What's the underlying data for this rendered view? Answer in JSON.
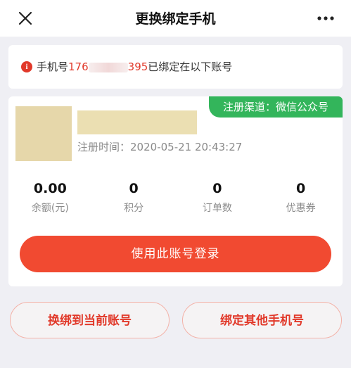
{
  "header": {
    "title": "更换绑定手机"
  },
  "notice": {
    "prefix": "手机号",
    "phone_start": "176",
    "phone_end": "395",
    "suffix": "已绑定在以下账号"
  },
  "account": {
    "channel_badge": "注册渠道：微信公众号",
    "reg_time_label": "注册时间：",
    "reg_time_value": "2020-05-21 20:43:27",
    "stats": [
      {
        "value": "0.00",
        "label": "余额(元)"
      },
      {
        "value": "0",
        "label": "积分"
      },
      {
        "value": "0",
        "label": "订单数"
      },
      {
        "value": "0",
        "label": "优惠券"
      }
    ],
    "login_button": "使用此账号登录"
  },
  "actions": {
    "rebind_current": "换绑到当前账号",
    "bind_other": "绑定其他手机号"
  },
  "colors": {
    "accent": "#f14a31",
    "badge_green": "#33b55b",
    "text_red": "#e1392a"
  }
}
